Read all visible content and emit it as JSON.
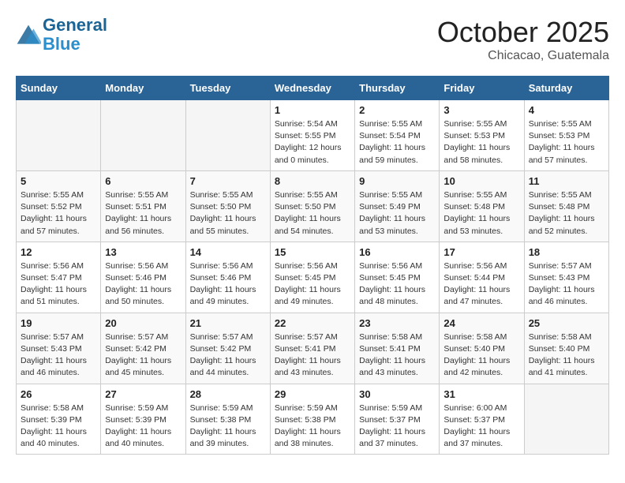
{
  "header": {
    "logo_line1": "General",
    "logo_line2": "Blue",
    "month": "October 2025",
    "location": "Chicacao, Guatemala"
  },
  "days_of_week": [
    "Sunday",
    "Monday",
    "Tuesday",
    "Wednesday",
    "Thursday",
    "Friday",
    "Saturday"
  ],
  "weeks": [
    [
      {
        "day": "",
        "info": ""
      },
      {
        "day": "",
        "info": ""
      },
      {
        "day": "",
        "info": ""
      },
      {
        "day": "1",
        "info": "Sunrise: 5:54 AM\nSunset: 5:55 PM\nDaylight: 12 hours\nand 0 minutes."
      },
      {
        "day": "2",
        "info": "Sunrise: 5:55 AM\nSunset: 5:54 PM\nDaylight: 11 hours\nand 59 minutes."
      },
      {
        "day": "3",
        "info": "Sunrise: 5:55 AM\nSunset: 5:53 PM\nDaylight: 11 hours\nand 58 minutes."
      },
      {
        "day": "4",
        "info": "Sunrise: 5:55 AM\nSunset: 5:53 PM\nDaylight: 11 hours\nand 57 minutes."
      }
    ],
    [
      {
        "day": "5",
        "info": "Sunrise: 5:55 AM\nSunset: 5:52 PM\nDaylight: 11 hours\nand 57 minutes."
      },
      {
        "day": "6",
        "info": "Sunrise: 5:55 AM\nSunset: 5:51 PM\nDaylight: 11 hours\nand 56 minutes."
      },
      {
        "day": "7",
        "info": "Sunrise: 5:55 AM\nSunset: 5:50 PM\nDaylight: 11 hours\nand 55 minutes."
      },
      {
        "day": "8",
        "info": "Sunrise: 5:55 AM\nSunset: 5:50 PM\nDaylight: 11 hours\nand 54 minutes."
      },
      {
        "day": "9",
        "info": "Sunrise: 5:55 AM\nSunset: 5:49 PM\nDaylight: 11 hours\nand 53 minutes."
      },
      {
        "day": "10",
        "info": "Sunrise: 5:55 AM\nSunset: 5:48 PM\nDaylight: 11 hours\nand 53 minutes."
      },
      {
        "day": "11",
        "info": "Sunrise: 5:55 AM\nSunset: 5:48 PM\nDaylight: 11 hours\nand 52 minutes."
      }
    ],
    [
      {
        "day": "12",
        "info": "Sunrise: 5:56 AM\nSunset: 5:47 PM\nDaylight: 11 hours\nand 51 minutes."
      },
      {
        "day": "13",
        "info": "Sunrise: 5:56 AM\nSunset: 5:46 PM\nDaylight: 11 hours\nand 50 minutes."
      },
      {
        "day": "14",
        "info": "Sunrise: 5:56 AM\nSunset: 5:46 PM\nDaylight: 11 hours\nand 49 minutes."
      },
      {
        "day": "15",
        "info": "Sunrise: 5:56 AM\nSunset: 5:45 PM\nDaylight: 11 hours\nand 49 minutes."
      },
      {
        "day": "16",
        "info": "Sunrise: 5:56 AM\nSunset: 5:45 PM\nDaylight: 11 hours\nand 48 minutes."
      },
      {
        "day": "17",
        "info": "Sunrise: 5:56 AM\nSunset: 5:44 PM\nDaylight: 11 hours\nand 47 minutes."
      },
      {
        "day": "18",
        "info": "Sunrise: 5:57 AM\nSunset: 5:43 PM\nDaylight: 11 hours\nand 46 minutes."
      }
    ],
    [
      {
        "day": "19",
        "info": "Sunrise: 5:57 AM\nSunset: 5:43 PM\nDaylight: 11 hours\nand 46 minutes."
      },
      {
        "day": "20",
        "info": "Sunrise: 5:57 AM\nSunset: 5:42 PM\nDaylight: 11 hours\nand 45 minutes."
      },
      {
        "day": "21",
        "info": "Sunrise: 5:57 AM\nSunset: 5:42 PM\nDaylight: 11 hours\nand 44 minutes."
      },
      {
        "day": "22",
        "info": "Sunrise: 5:57 AM\nSunset: 5:41 PM\nDaylight: 11 hours\nand 43 minutes."
      },
      {
        "day": "23",
        "info": "Sunrise: 5:58 AM\nSunset: 5:41 PM\nDaylight: 11 hours\nand 43 minutes."
      },
      {
        "day": "24",
        "info": "Sunrise: 5:58 AM\nSunset: 5:40 PM\nDaylight: 11 hours\nand 42 minutes."
      },
      {
        "day": "25",
        "info": "Sunrise: 5:58 AM\nSunset: 5:40 PM\nDaylight: 11 hours\nand 41 minutes."
      }
    ],
    [
      {
        "day": "26",
        "info": "Sunrise: 5:58 AM\nSunset: 5:39 PM\nDaylight: 11 hours\nand 40 minutes."
      },
      {
        "day": "27",
        "info": "Sunrise: 5:59 AM\nSunset: 5:39 PM\nDaylight: 11 hours\nand 40 minutes."
      },
      {
        "day": "28",
        "info": "Sunrise: 5:59 AM\nSunset: 5:38 PM\nDaylight: 11 hours\nand 39 minutes."
      },
      {
        "day": "29",
        "info": "Sunrise: 5:59 AM\nSunset: 5:38 PM\nDaylight: 11 hours\nand 38 minutes."
      },
      {
        "day": "30",
        "info": "Sunrise: 5:59 AM\nSunset: 5:37 PM\nDaylight: 11 hours\nand 37 minutes."
      },
      {
        "day": "31",
        "info": "Sunrise: 6:00 AM\nSunset: 5:37 PM\nDaylight: 11 hours\nand 37 minutes."
      },
      {
        "day": "",
        "info": ""
      }
    ]
  ]
}
